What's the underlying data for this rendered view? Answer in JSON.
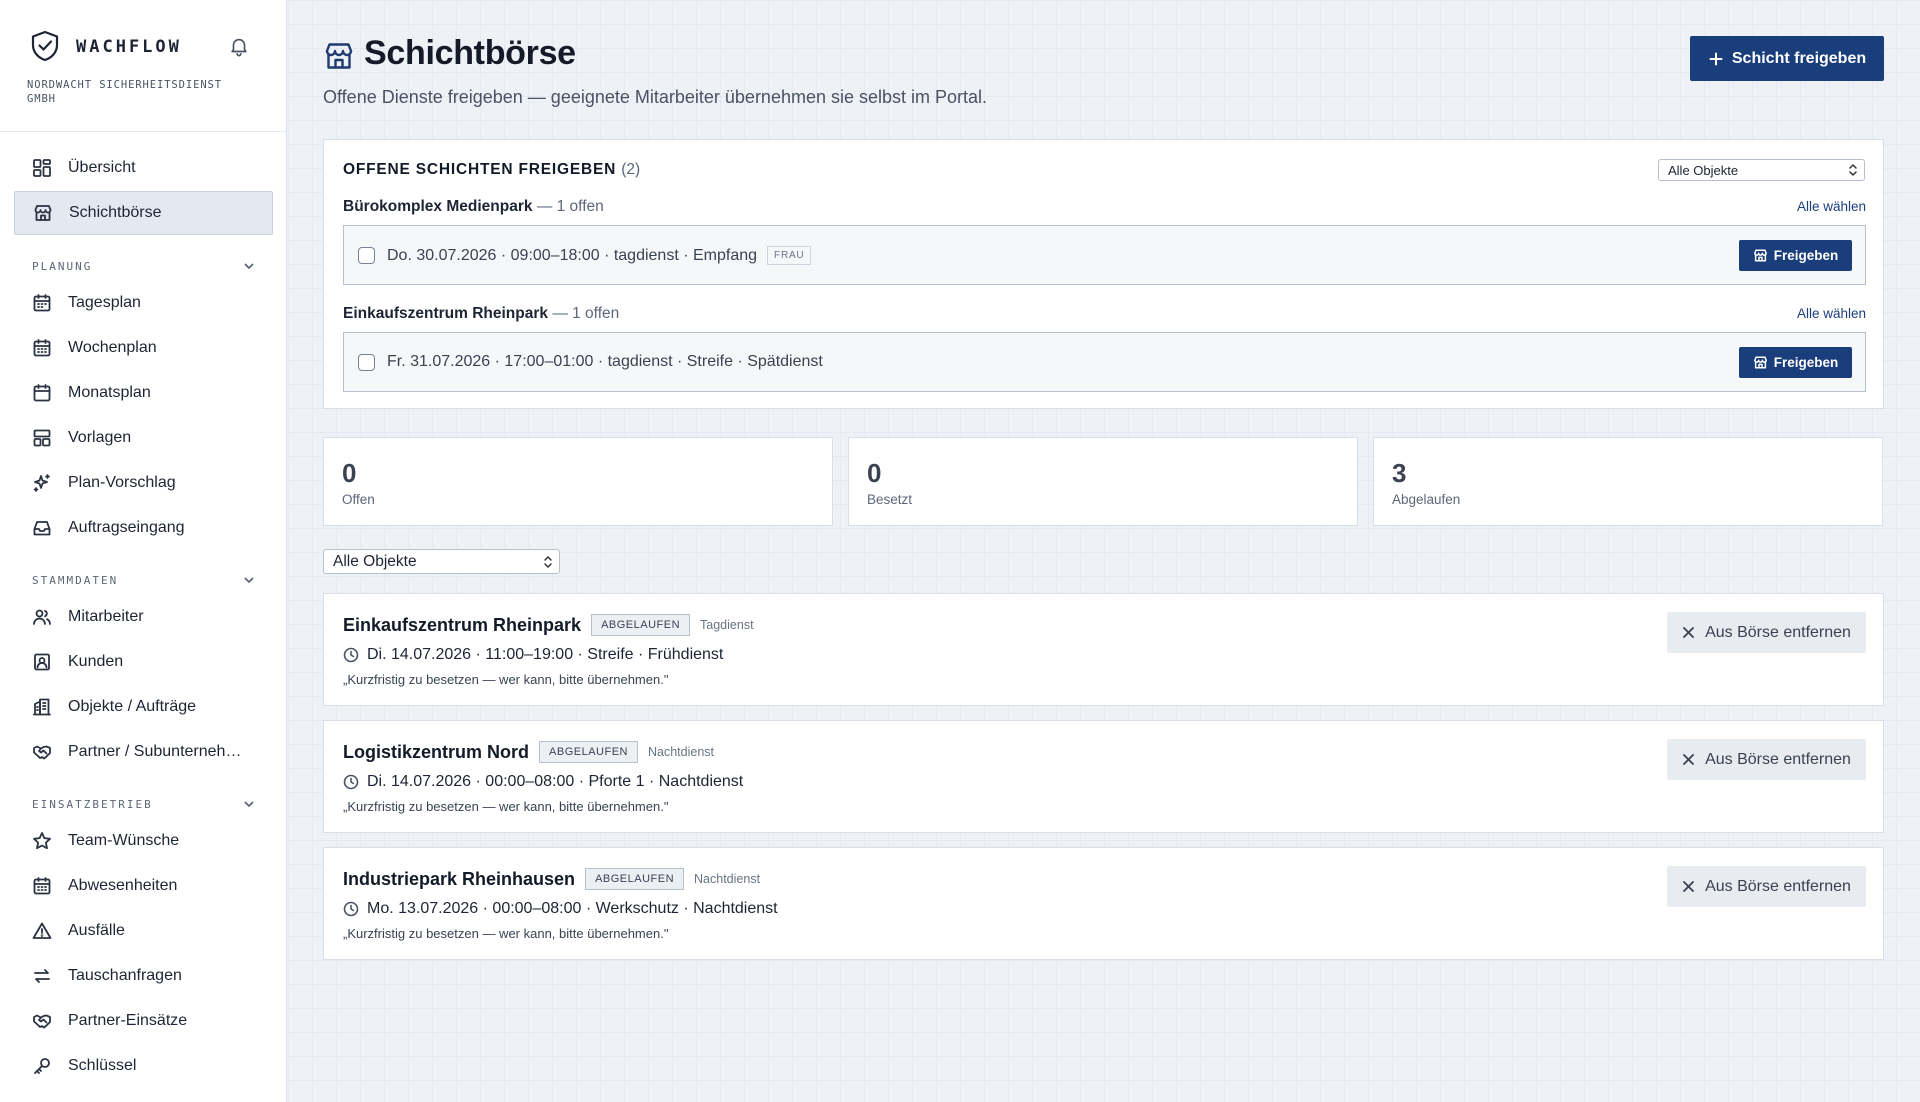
{
  "app": {
    "name": "WACHFLOW",
    "company": "NORDWACHT SICHERHEITSDIENST GMBH"
  },
  "sidebar": {
    "top_items": [
      {
        "label": "Übersicht",
        "icon": "dashboard-icon"
      },
      {
        "label": "Schichtbörse",
        "icon": "store-icon",
        "active": true
      }
    ],
    "sections": [
      {
        "title": "PLANUNG",
        "items": [
          {
            "label": "Tagesplan",
            "icon": "calendar-day-icon"
          },
          {
            "label": "Wochenplan",
            "icon": "calendar-week-icon"
          },
          {
            "label": "Monatsplan",
            "icon": "calendar-icon"
          },
          {
            "label": "Vorlagen",
            "icon": "template-icon"
          },
          {
            "label": "Plan-Vorschlag",
            "icon": "sparkles-icon"
          },
          {
            "label": "Auftragseingang",
            "icon": "inbox-icon"
          }
        ]
      },
      {
        "title": "STAMMDATEN",
        "items": [
          {
            "label": "Mitarbeiter",
            "icon": "users-icon"
          },
          {
            "label": "Kunden",
            "icon": "contact-icon"
          },
          {
            "label": "Objekte / Aufträge",
            "icon": "building-icon"
          },
          {
            "label": "Partner / Subunterneh…",
            "icon": "handshake-icon"
          }
        ]
      },
      {
        "title": "EINSATZBETRIEB",
        "items": [
          {
            "label": "Team-Wünsche",
            "icon": "star-icon"
          },
          {
            "label": "Abwesenheiten",
            "icon": "calendar-x-icon"
          },
          {
            "label": "Ausfälle",
            "icon": "warning-icon"
          },
          {
            "label": "Tauschanfragen",
            "icon": "swap-icon"
          },
          {
            "label": "Partner-Einsätze",
            "icon": "handshake-icon"
          },
          {
            "label": "Schlüssel",
            "icon": "key-icon"
          }
        ]
      }
    ]
  },
  "header": {
    "title": "Schichtbörse",
    "subtitle": "Offene Dienste freigeben — geeignete Mitarbeiter übernehmen sie selbst im Portal.",
    "primary_button": "Schicht freigeben"
  },
  "open_shifts": {
    "title": "OFFENE SCHICHTEN FREIGEBEN",
    "count": "(2)",
    "filter_value": "Alle Objekte",
    "select_all_label": "Alle wählen",
    "release_label": "Freigeben",
    "groups": [
      {
        "name": "Bürokomplex Medienpark",
        "meta": "— 1 offen",
        "shift": "Do. 30.07.2026 · 09:00–18:00 · tagdienst · Empfang",
        "tag": "FRAU"
      },
      {
        "name": "Einkaufszentrum Rheinpark",
        "meta": "— 1 offen",
        "shift": "Fr. 31.07.2026 · 17:00–01:00 · tagdienst · Streife · Spätdienst",
        "tag": ""
      }
    ]
  },
  "stats": [
    {
      "value": "0",
      "label": "Offen"
    },
    {
      "value": "0",
      "label": "Besetzt"
    },
    {
      "value": "3",
      "label": "Abgelaufen"
    }
  ],
  "filter": {
    "value": "Alle Objekte"
  },
  "listings": {
    "remove_label": "Aus Börse entfernen",
    "items": [
      {
        "object": "Einkaufszentrum Rheinpark",
        "status": "ABGELAUFEN",
        "type": "Tagdienst",
        "details": "Di. 14.07.2026 · 11:00–19:00 · Streife · Frühdienst",
        "note": "„Kurzfristig zu besetzen — wer kann, bitte übernehmen.\""
      },
      {
        "object": "Logistikzentrum Nord",
        "status": "ABGELAUFEN",
        "type": "Nachtdienst",
        "details": "Di. 14.07.2026 · 00:00–08:00 · Pforte 1 · Nachtdienst",
        "note": "„Kurzfristig zu besetzen — wer kann, bitte übernehmen.\""
      },
      {
        "object": "Industriepark Rheinhausen",
        "status": "ABGELAUFEN",
        "type": "Nachtdienst",
        "details": "Mo. 13.07.2026 · 00:00–08:00 · Werkschutz · Nachtdienst",
        "note": "„Kurzfristig zu besetzen — wer kann, bitte übernehmen.\""
      }
    ]
  },
  "colors": {
    "primary": "#1a3d7c",
    "background": "#eef1f6",
    "text": "#1e2433",
    "badge_bg": "#eceff4"
  }
}
